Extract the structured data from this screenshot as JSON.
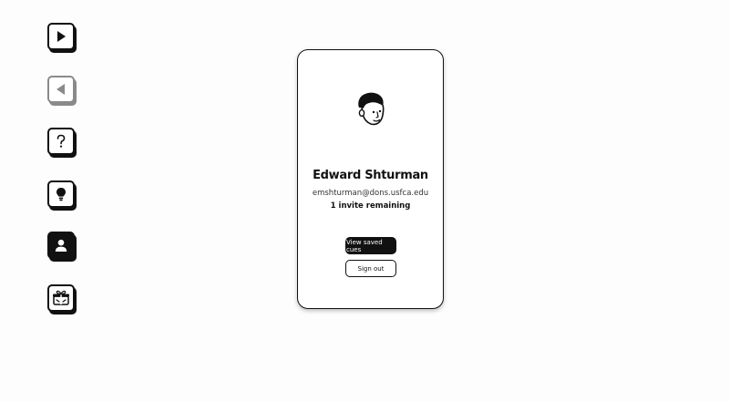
{
  "sidebar": {
    "items": [
      {
        "name": "play-button",
        "icon": "play-icon",
        "state": "enabled"
      },
      {
        "name": "back-button",
        "icon": "back-arrow-icon",
        "state": "disabled"
      },
      {
        "name": "help-button",
        "icon": "question-mark-icon",
        "state": "enabled"
      },
      {
        "name": "hint-button",
        "icon": "lightbulb-icon",
        "state": "enabled"
      },
      {
        "name": "profile-button",
        "icon": "person-icon",
        "state": "active"
      },
      {
        "name": "gift-button",
        "icon": "gift-icon",
        "state": "enabled"
      }
    ]
  },
  "profile": {
    "avatar_icon": "face-avatar-icon",
    "name": "Edward Shturman",
    "email": "emshturman@dons.usfca.edu",
    "invites": "1 invite remaining",
    "view_saved_label": "View saved cues",
    "sign_out_label": "Sign out"
  },
  "colors": {
    "ink": "#111111",
    "disabled": "#8a8a8a",
    "background": "#fdfdfd"
  }
}
